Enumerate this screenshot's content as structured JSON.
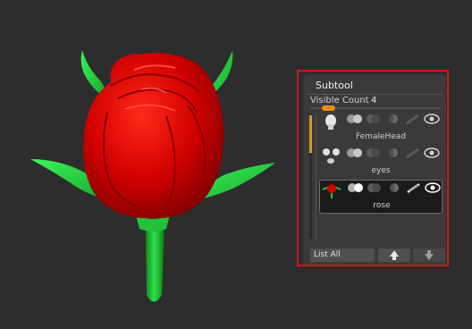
{
  "subtool_panel": {
    "title": "Subtool",
    "visible_count_label": "Visible Count",
    "visible_count_value": "4",
    "slider_level": 0.1,
    "items": [
      {
        "name": "FemaleHead",
        "selected": false
      },
      {
        "name": "eyes",
        "selected": false
      },
      {
        "name": "rose",
        "selected": true
      }
    ],
    "list_all_label": "List All",
    "second_row_label": "",
    "icons": [
      "thumbnail",
      "polypaint-icon",
      "dynamesh-icon",
      "solo-icon",
      "visibility-eye-icon",
      "arrow-up-icon",
      "arrow-down-icon"
    ]
  },
  "colors": {
    "background": "#2d2d2d",
    "rose_red": "#d40000",
    "leaf_green": "#22c23a",
    "highlight_red": "#d4161a",
    "accent_orange": "#f08a1c"
  }
}
